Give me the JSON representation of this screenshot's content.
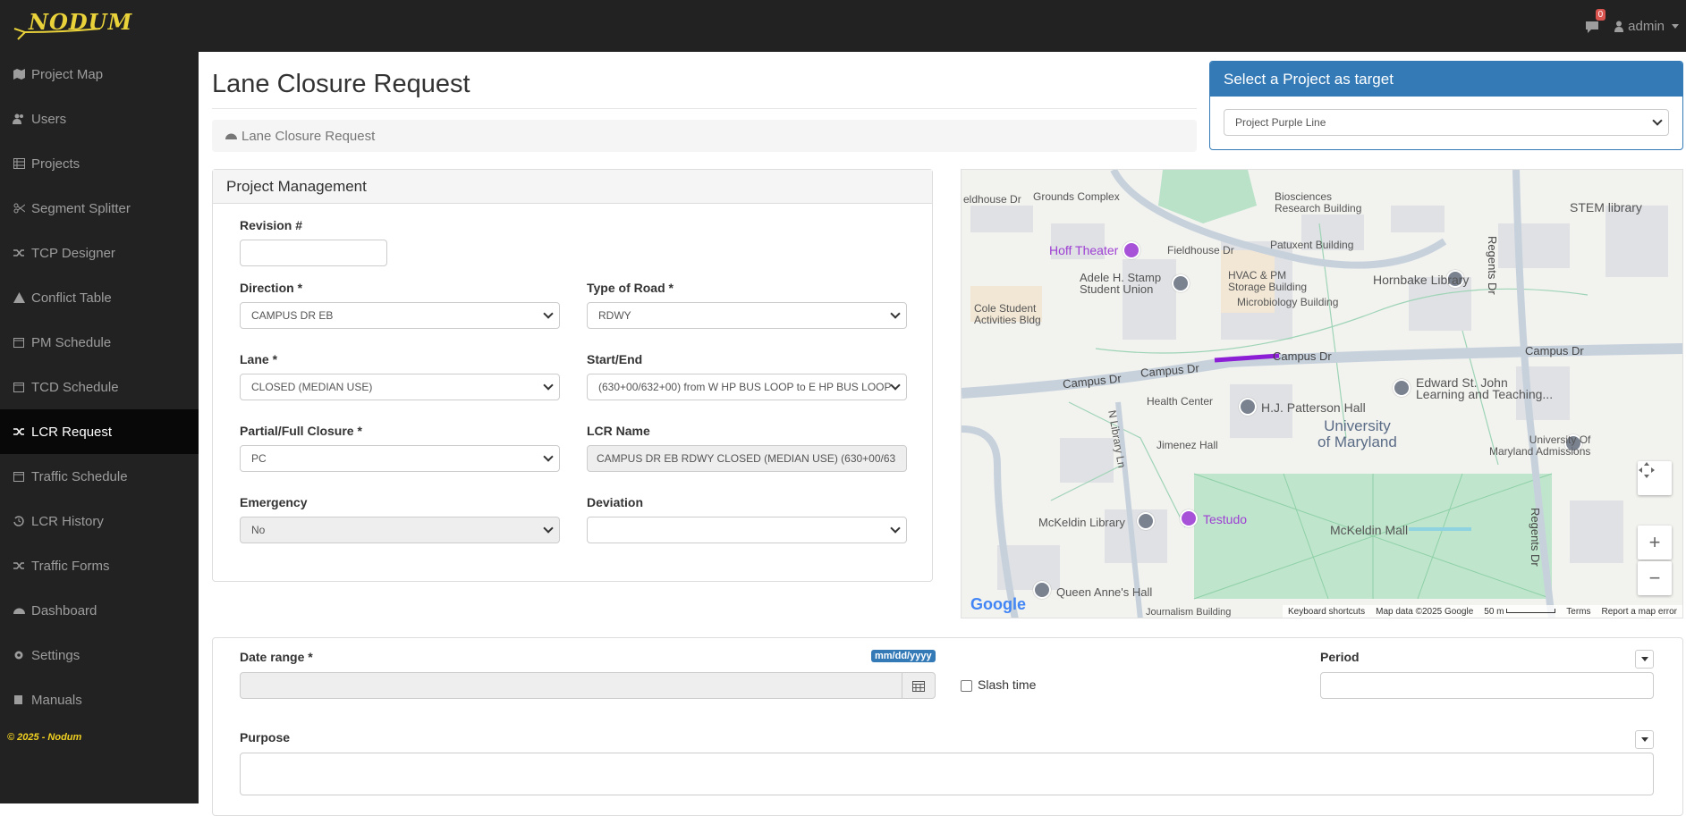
{
  "brand": {
    "logo_text": "NODUM"
  },
  "topbar": {
    "notification_count": "0",
    "user": "admin"
  },
  "sidebar": {
    "items": [
      {
        "label": "Project Map",
        "icon": "map-icon"
      },
      {
        "label": "Users",
        "icon": "users-icon"
      },
      {
        "label": "Projects",
        "icon": "table-icon"
      },
      {
        "label": "Segment Splitter",
        "icon": "scissors-icon"
      },
      {
        "label": "TCP Designer",
        "icon": "random-icon"
      },
      {
        "label": "Conflict Table",
        "icon": "warning-icon"
      },
      {
        "label": "PM Schedule",
        "icon": "calendar-icon"
      },
      {
        "label": "TCD Schedule",
        "icon": "calendar-icon"
      },
      {
        "label": "LCR Request",
        "icon": "random-icon",
        "active": true
      },
      {
        "label": "Traffic Schedule",
        "icon": "calendar-icon"
      },
      {
        "label": "LCR History",
        "icon": "history-icon"
      },
      {
        "label": "Traffic Forms",
        "icon": "random-icon"
      },
      {
        "label": "Dashboard",
        "icon": "dashboard-icon"
      },
      {
        "label": "Settings",
        "icon": "gear-icon"
      },
      {
        "label": "Manuals",
        "icon": "book-icon"
      }
    ],
    "copyright": "© 2025 - Nodum"
  },
  "page": {
    "title": "Lane Closure Request",
    "breadcrumb": "Lane Closure Request"
  },
  "target": {
    "heading": "Select a Project as target",
    "selected": "Project Purple Line"
  },
  "project_management": {
    "heading": "Project Management",
    "revision_label": "Revision #",
    "revision_value": "",
    "direction_label": "Direction",
    "direction_value": "CAMPUS DR EB",
    "road_type_label": "Type of Road",
    "road_type_value": "RDWY",
    "lane_label": "Lane",
    "lane_value": "CLOSED (MEDIAN USE)",
    "start_end_label": "Start/End",
    "start_end_value": "(630+00/632+00) from W HP BUS LOOP to E HP BUS LOOP",
    "closure_label": "Partial/Full Closure",
    "closure_value": "PC",
    "lcr_name_label": "LCR Name",
    "lcr_name_value": "CAMPUS DR EB RDWY CLOSED (MEDIAN USE) (630+00/63",
    "emergency_label": "Emergency",
    "emergency_value": "No",
    "deviation_label": "Deviation",
    "deviation_value": "",
    "required_mark": "*"
  },
  "map": {
    "labels": {
      "fieldhouse": "eldhouse Dr",
      "grounds": "Grounds Complex",
      "biosciences": "Biosciences\nResearch Building",
      "stem": "STEM library",
      "hoff": "Hoff Theater",
      "fieldhouse_dr": "Fieldhouse Dr",
      "patuxent": "Patuxent Building",
      "stamp": "Adele H. Stamp\nStudent Union",
      "hvac": "HVAC & PM\nStorage Building",
      "hornbake": "Hornbake Library",
      "microbio": "Microbiology Building",
      "cole": "Cole Student\nActivities Bldg",
      "regents1": "Regents Dr",
      "campus1": "Campus Dr",
      "campus2": "Campus Dr",
      "campus3": "Campus Dr",
      "campus4": "Campus Dr",
      "health": "Health Center",
      "patterson": "H.J. Patterson Hall",
      "stjohn": "Edward St. John\nLearning and Teaching...",
      "nlibrary": "N Library Ln",
      "umd": "University\nof Maryland",
      "admissions": "University Of\nMaryland Admissions",
      "jimenez": "Jimenez Hall",
      "mckeldin_lib": "McKeldin Library",
      "testudo": "Testudo",
      "mall": "McKeldin Mall",
      "regents2": "Regents Dr",
      "queen": "Queen Anne's Hall",
      "journalism": "Journalism Building"
    },
    "footer": {
      "shortcuts": "Keyboard shortcuts",
      "data": "Map data ©2025 Google",
      "scale": "50 m",
      "terms": "Terms",
      "report": "Report a map error"
    },
    "google": "Google"
  },
  "dates": {
    "range_label": "Date range",
    "format_hint": "mm/dd/yyyy",
    "slash_label": "Slash time",
    "period_label": "Period",
    "purpose_label": "Purpose"
  }
}
